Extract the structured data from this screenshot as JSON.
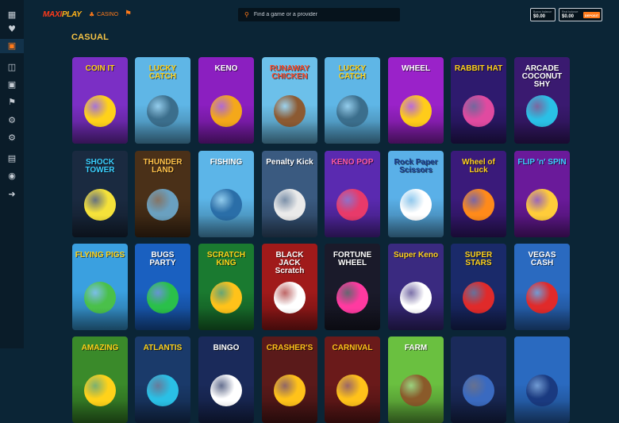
{
  "brand": {
    "logo_text_1": "MAXI",
    "logo_text_2": "PLAY"
  },
  "nav": {
    "casino": "CASINO",
    "casino_icon": "casino-icon",
    "trophy_icon": "trophy-icon"
  },
  "search": {
    "placeholder": "Find a game or a provider"
  },
  "balances": {
    "bonus_label": "Bonus balance",
    "bonus_value": "$0.00",
    "real_label": "Real balance",
    "real_value": "$0.00",
    "deposit": "DEPOSIT"
  },
  "section": {
    "title": "CASUAL"
  },
  "sidebar_icons": [
    "grid-icon",
    "heart-icon",
    "casino-chip-icon",
    "cards-icon",
    "gift-icon",
    "trophy-icon",
    "settings-icon",
    "settings-icon-2",
    "dashboard-icon",
    "chat-icon",
    "logout-icon"
  ],
  "games": [
    {
      "title": "COIN IT",
      "bg": "#7b2fc5",
      "accent": "#ffd21a",
      "text": "#ffd21a"
    },
    {
      "title": "LUCKY CATCH",
      "bg": "#5fb6e6",
      "accent": "#3b6e8c",
      "text": "#ffd21a"
    },
    {
      "title": "KENO",
      "bg": "#8b1fc0",
      "accent": "#f4a81a",
      "text": "#ffffff"
    },
    {
      "title": "RUNAWAY CHICKEN",
      "bg": "#6cc0ea",
      "accent": "#8c5a32",
      "text": "#ff4a2a"
    },
    {
      "title": "LUCKY CATCH",
      "bg": "#5fb6e6",
      "accent": "#3b6e8c",
      "text": "#ffd21a"
    },
    {
      "title": "WHEEL",
      "bg": "#9a22c9",
      "accent": "#ffcc1a",
      "text": "#ffffff"
    },
    {
      "title": "RABBIT HAT",
      "bg": "#2e1a6e",
      "accent": "#e04aa0",
      "text": "#ffd21a"
    },
    {
      "title": "ARCADE COCONUT SHY",
      "bg": "#3a1a70",
      "accent": "#2ac0e6",
      "text": "#ffffff"
    },
    {
      "title": "SHOCK TOWER",
      "bg": "#1a2a40",
      "accent": "#f5e23a",
      "text": "#3ad0ff"
    },
    {
      "title": "THUNDER LAND",
      "bg": "#4a3018",
      "accent": "#6aa0c0",
      "text": "#ffc24a"
    },
    {
      "title": "FISHING",
      "bg": "#5cb5e8",
      "accent": "#2a6ea8",
      "text": "#ffffff"
    },
    {
      "title": "Penalty Kick",
      "bg": "#3a5a80",
      "accent": "#eaeaea",
      "text": "#ffffff"
    },
    {
      "title": "KENO POP",
      "bg": "#5a2ab0",
      "accent": "#e83a6a",
      "text": "#ff5aa0"
    },
    {
      "title": "Rock Paper Scissors",
      "bg": "#5ab0e8",
      "accent": "#ffffff",
      "text": "#1a3a8a"
    },
    {
      "title": "Wheel of Luck",
      "bg": "#3a1a7a",
      "accent": "#ff8a1a",
      "text": "#ffd21a"
    },
    {
      "title": "FLIP 'n' SPIN",
      "bg": "#6a1a9a",
      "accent": "#ffcc3a",
      "text": "#3ad0ff"
    },
    {
      "title": "FLYING PIGS",
      "bg": "#3aa0e0",
      "accent": "#4ac04a",
      "text": "#ffd21a"
    },
    {
      "title": "BUGS PARTY",
      "bg": "#1a60c0",
      "accent": "#2ac04a",
      "text": "#ffffff"
    },
    {
      "title": "SCRATCH KING",
      "bg": "#1a7a30",
      "accent": "#ffc21a",
      "text": "#ffd21a"
    },
    {
      "title": "BLACK JACK Scratch",
      "bg": "#a01a1a",
      "accent": "#ffffff",
      "text": "#ffffff"
    },
    {
      "title": "FORTUNE WHEEL",
      "bg": "#1a1a2a",
      "accent": "#ff3aa0",
      "text": "#ffffff"
    },
    {
      "title": "Super Keno",
      "bg": "#3a2a80",
      "accent": "#ffffff",
      "text": "#ffd21a"
    },
    {
      "title": "SUPER STARS",
      "bg": "#1a2a6a",
      "accent": "#e02a2a",
      "text": "#ffd21a"
    },
    {
      "title": "VEGAS CASH",
      "bg": "#2a6ac0",
      "accent": "#e02a2a",
      "text": "#ffffff"
    },
    {
      "title": "AMAZING",
      "bg": "#3a8a2a",
      "accent": "#ffd21a",
      "text": "#ffd21a"
    },
    {
      "title": "ATLANTIS",
      "bg": "#1a3a6a",
      "accent": "#2ac0e6",
      "text": "#ffd21a"
    },
    {
      "title": "BINGO",
      "bg": "#1a2a5a",
      "accent": "#ffffff",
      "text": "#ffffff"
    },
    {
      "title": "CRASHER'S",
      "bg": "#5a1a1a",
      "accent": "#ffc21a",
      "text": "#ffc21a"
    },
    {
      "title": "CARNIVAL",
      "bg": "#6a1a1a",
      "accent": "#ffc21a",
      "text": "#ffc21a"
    },
    {
      "title": "FARM",
      "bg": "#6ac040",
      "accent": "#8a5a2a",
      "text": "#ffffff"
    },
    {
      "title": "",
      "bg": "#1a2a5a",
      "accent": "#3a6ac0",
      "text": "#ffffff"
    },
    {
      "title": "",
      "bg": "#2a6ac0",
      "accent": "#1a3a80",
      "text": "#ffffff"
    }
  ]
}
